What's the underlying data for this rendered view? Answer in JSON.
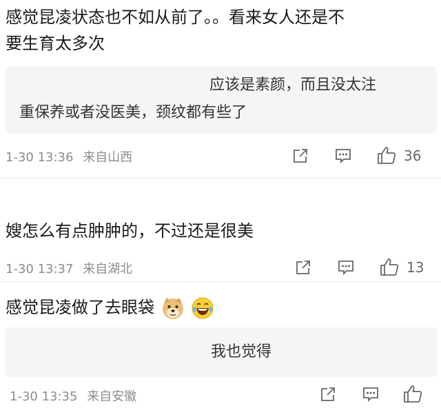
{
  "comments": [
    {
      "text_line1": "感觉昆凌状态也不如从前了。。看来女人还是不",
      "text_line2": "要生育太多次",
      "reply_line1": "应该是素颜，而且没太注",
      "reply_line2": "重保养或者没医美，颈纹都有些了",
      "time": "1-30 13:36",
      "location": "来自山西",
      "likes": "36"
    },
    {
      "text_line1": "嫂怎么有点肿肿的，不过还是很美",
      "time": "1-30 13:37",
      "location": "来自湖北",
      "likes": "13"
    },
    {
      "text_line1": "感觉昆凌做了去眼袋",
      "reply_line1": "我也觉得",
      "time": "1-30 13:35",
      "location": "来自安徽",
      "likes": ""
    }
  ],
  "icons": {
    "share": "share-icon",
    "comment": "comment-icon",
    "like": "thumbs-up-icon",
    "emoji_doge": "doge-emoji-icon",
    "emoji_laugh": "laugh-cry-emoji-icon"
  },
  "colors": {
    "text": "#1a1a1a",
    "meta": "#8c8c8c",
    "reply_bg": "#f5f5f5",
    "icon": "#666666"
  }
}
